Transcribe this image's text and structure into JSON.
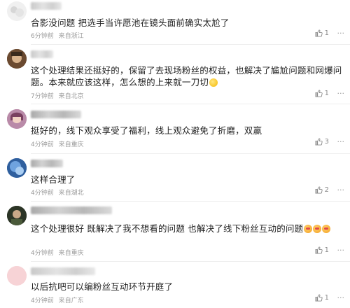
{
  "comments": [
    {
      "text": "合影没问题 把选手当许愿池在镜头面前确实太尬了",
      "time": "6分钟前",
      "location": "来自浙江",
      "likes": "1"
    },
    {
      "text": "这个处理结果还挺好的，保留了去现场粉丝的权益，也解决了尴尬问题和网爆问题。本来就应该这样，怎么想的上来就一刀切",
      "emoji": "sweat-smile-emoji",
      "time": "7分钟前",
      "location": "来自北京",
      "likes": "1"
    },
    {
      "text": "挺好的，线下观众享受了福利，线上观众避免了折磨，双赢",
      "time": "4分钟前",
      "location": "来自重庆",
      "likes": "3"
    },
    {
      "text": "这样合理了",
      "time": "4分钟前",
      "location": "来自湖北",
      "likes": "2"
    },
    {
      "text": "这个处理很好 既解决了我不想看的问题 也解决了线下粉丝互动的问题",
      "emoji": "heart-eyes-emoji",
      "time": "4分钟前",
      "location": "来自重庆",
      "likes": "1"
    },
    {
      "text": "以后抗吧可以编粉丝互动环节开庭了",
      "time": "4分钟前",
      "location": "来自广东",
      "likes": "1"
    }
  ],
  "more_glyph": "···",
  "like_icon": "thumbs-up-icon",
  "colors": {
    "text": "#1f1f1f",
    "meta": "#9a9a9a",
    "divider": "#eeeeee"
  }
}
